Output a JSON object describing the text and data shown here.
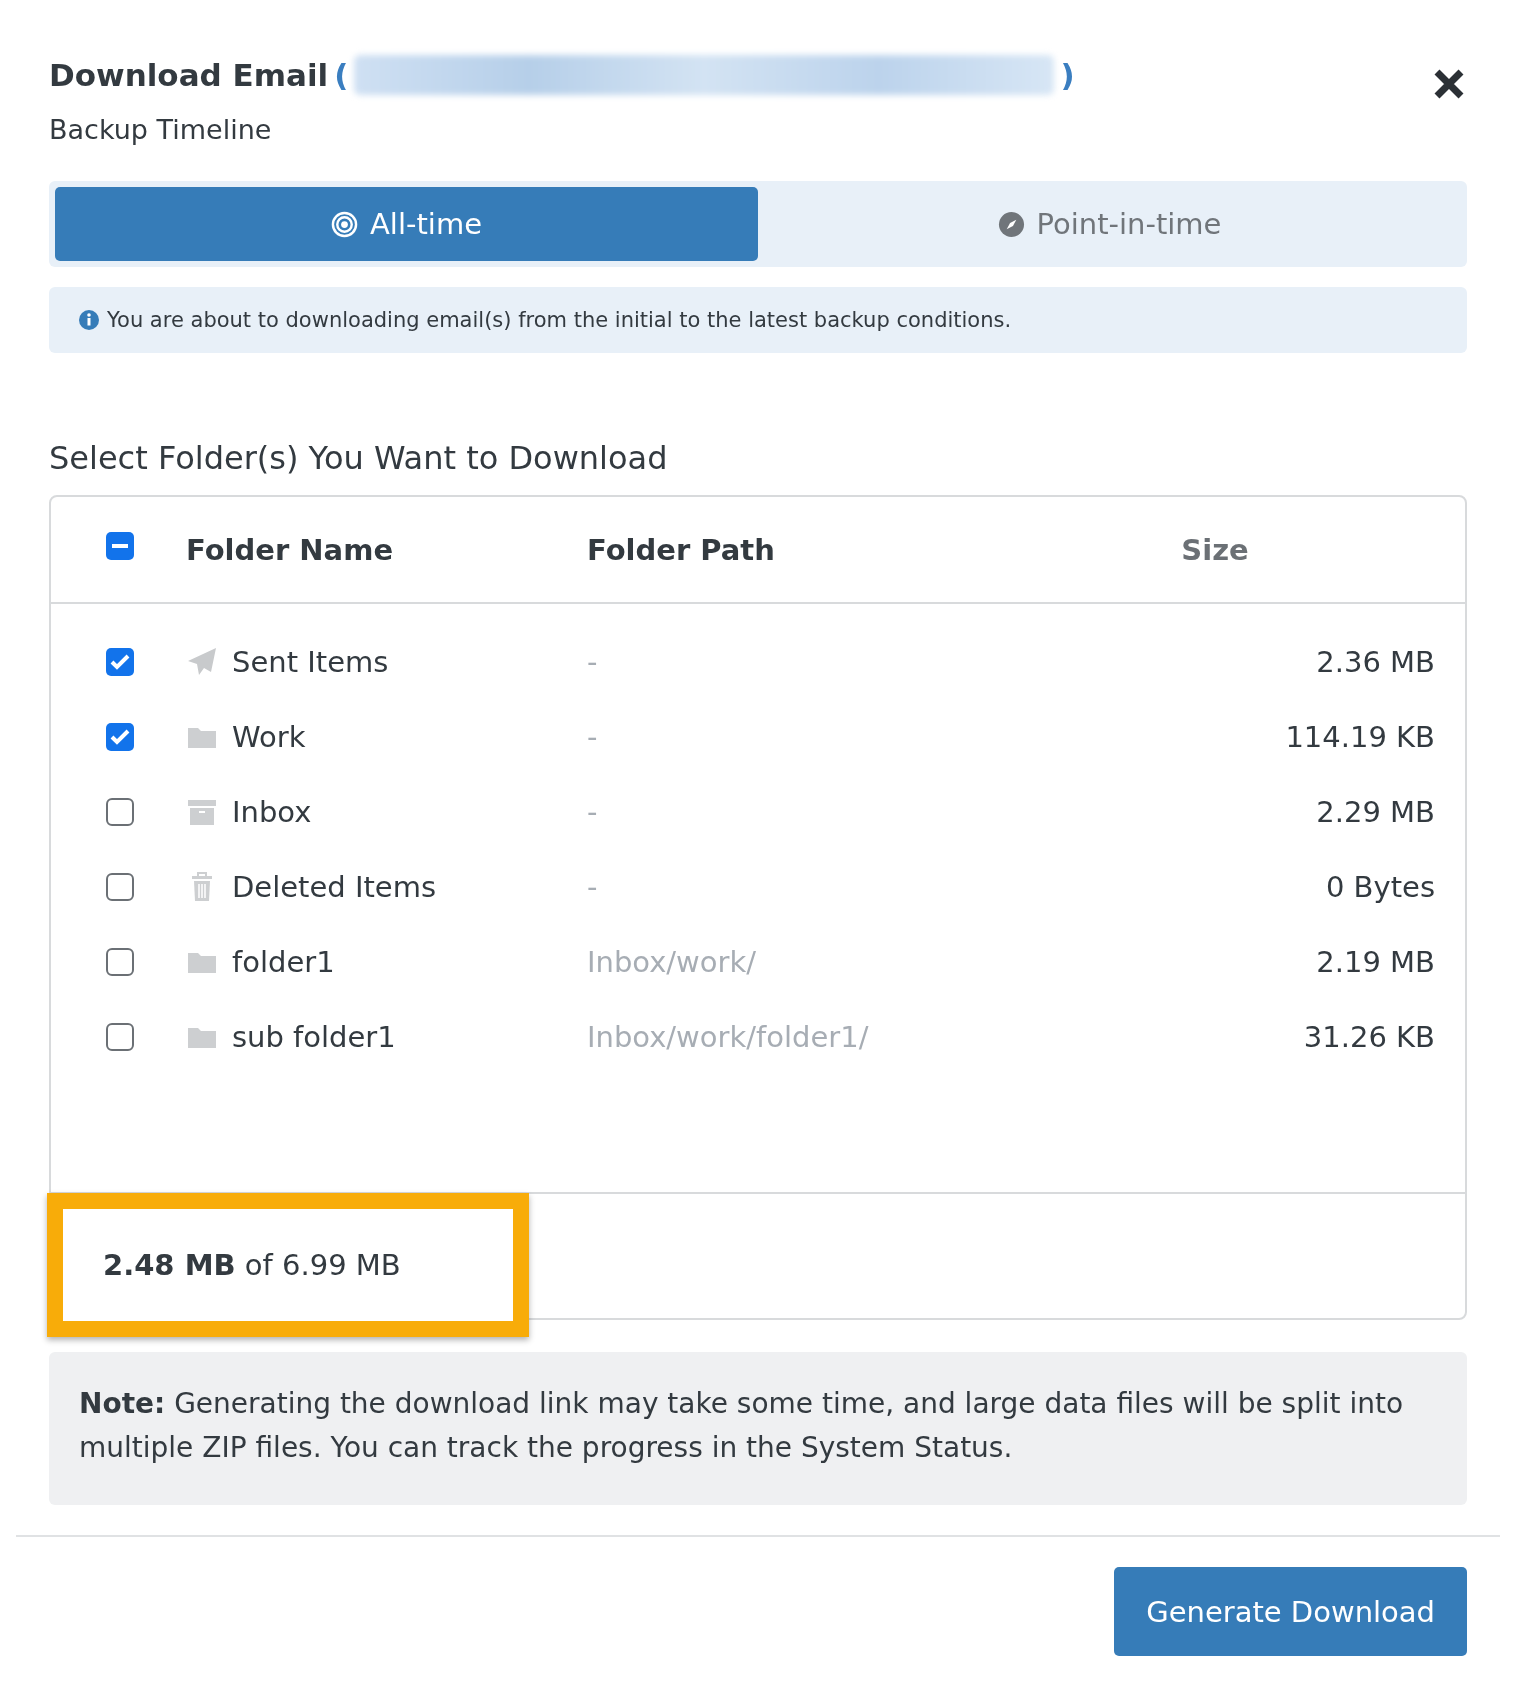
{
  "dialog": {
    "title": "Download Email",
    "title_open": "(",
    "title_close": ")",
    "subtitle": "Backup Timeline"
  },
  "tabs": [
    {
      "label": "All-time",
      "selected": true,
      "kind": "target"
    },
    {
      "label": "Point-in-time",
      "selected": false,
      "kind": "compass"
    }
  ],
  "info": "You are about to downloading email(s) from the initial to the latest backup conditions.",
  "section_title": "Select Folder(s) You Want to Download",
  "table": {
    "select_all": {
      "indeterminate": true
    },
    "columns": [
      "Folder Name",
      "Folder Path",
      "Size"
    ],
    "rows": [
      {
        "checked": true,
        "kind": "sent",
        "name": "Sent Items",
        "path": "-",
        "size": "2.36 MB"
      },
      {
        "checked": true,
        "kind": "folder",
        "name": "Work",
        "path": "-",
        "size": "114.19 KB"
      },
      {
        "checked": false,
        "kind": "archive",
        "name": "Inbox",
        "path": "-",
        "size": "2.29 MB"
      },
      {
        "checked": false,
        "kind": "trash",
        "name": "Deleted Items",
        "path": "-",
        "size": "0 Bytes"
      },
      {
        "checked": false,
        "kind": "folder",
        "name": "folder1",
        "path": "Inbox/work/",
        "size": "2.19 MB"
      },
      {
        "checked": false,
        "kind": "folder",
        "name": "sub folder1",
        "path": "Inbox/work/folder1/",
        "size": "31.26 KB"
      }
    ],
    "total": "**2.48 MB** of 6.99 MB",
    "total_highlighted": true
  },
  "note": "**Note:** Generating the download link may take some time, and large data files will be split into multiple ZIP files. You can track the progress in the System Status.",
  "button": "Generate Download"
}
